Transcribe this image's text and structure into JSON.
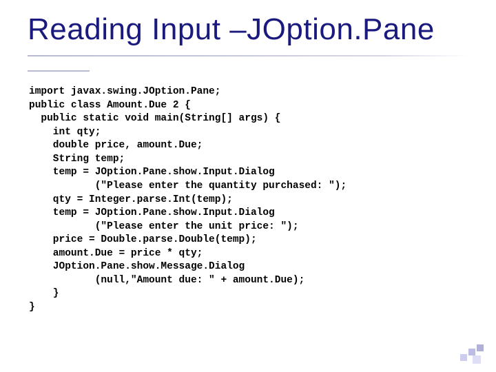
{
  "title": "Reading Input –JOption.Pane",
  "code_lines": [
    "import javax.swing.JOption.Pane;",
    "public class Amount.Due 2 {",
    "  public static void main(String[] args) {",
    "    int qty;",
    "    double price, amount.Due;",
    "    String temp;",
    "    temp = JOption.Pane.show.Input.Dialog",
    "           (\"Please enter the quantity purchased: \");",
    "    qty = Integer.parse.Int(temp);",
    "    temp = JOption.Pane.show.Input.Dialog",
    "           (\"Please enter the unit price: \");",
    "    price = Double.parse.Double(temp);",
    "    amount.Due = price * qty;",
    "    JOption.Pane.show.Message.Dialog",
    "           (null,\"Amount due: \" + amount.Due);",
    "    }",
    "}"
  ]
}
